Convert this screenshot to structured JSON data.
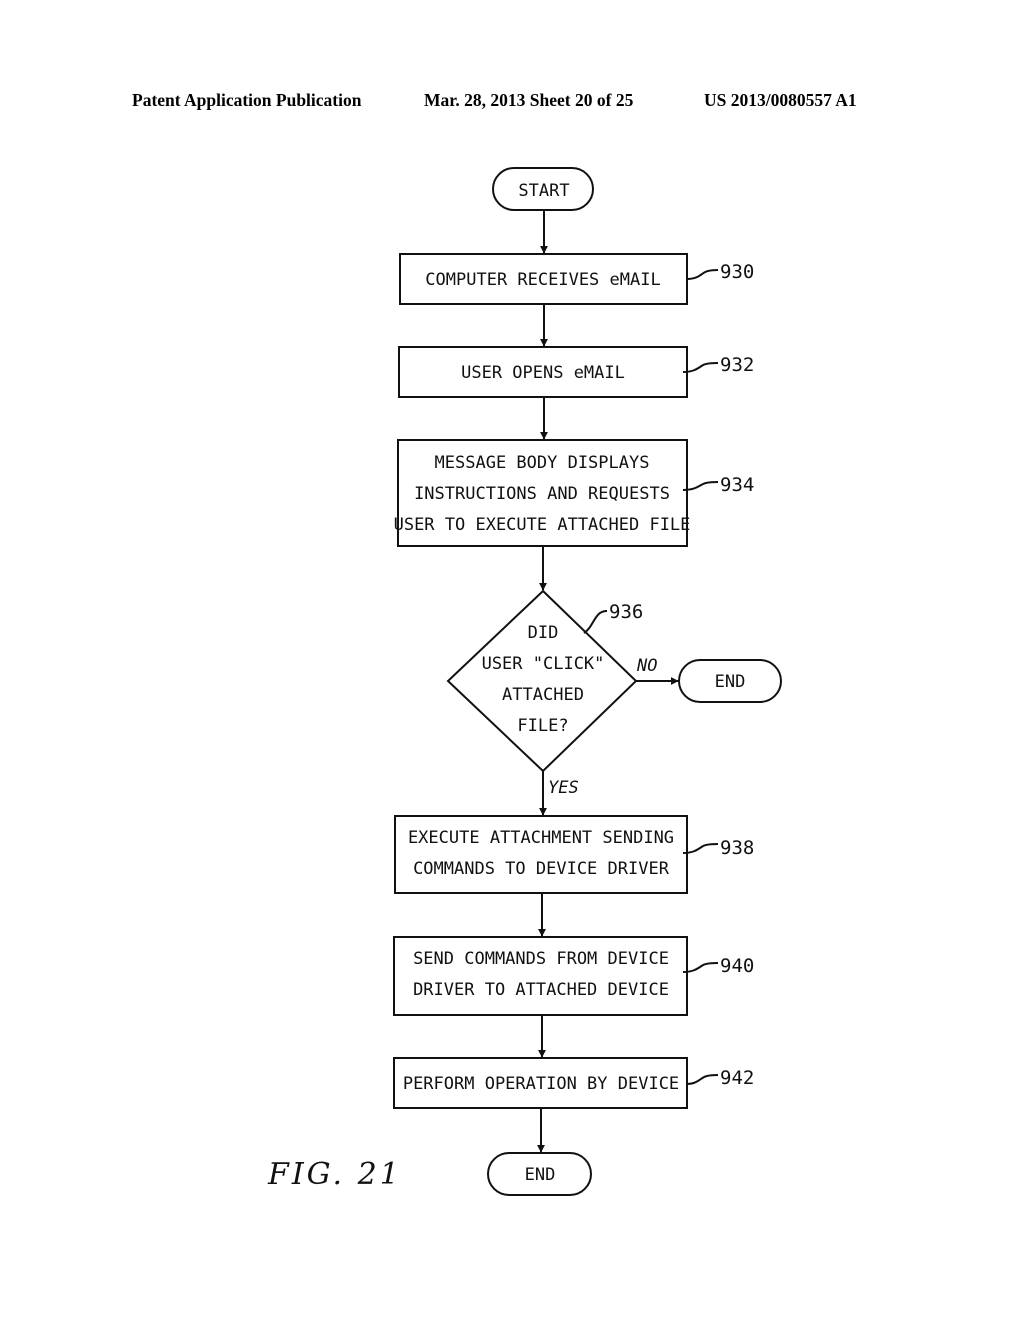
{
  "header": {
    "left": "Patent Application Publication",
    "middle": "Mar. 28, 2013  Sheet 20 of 25",
    "right": "US 2013/0080557 A1"
  },
  "figure_label": "FIG. 21",
  "flowchart": {
    "start": "START",
    "steps": [
      {
        "id": "930",
        "lines": [
          "COMPUTER RECEIVES eMAIL"
        ]
      },
      {
        "id": "932",
        "lines": [
          "USER OPENS eMAIL"
        ]
      },
      {
        "id": "934",
        "lines": [
          "MESSAGE BODY DISPLAYS",
          "INSTRUCTIONS AND REQUESTS",
          "USER TO EXECUTE ATTACHED FILE"
        ]
      }
    ],
    "decision": {
      "id": "936",
      "lines": [
        "DID",
        "USER \"CLICK\"",
        "ATTACHED",
        "FILE?"
      ],
      "no_label": "NO",
      "yes_label": "YES",
      "no_terminal": "END"
    },
    "after_steps": [
      {
        "id": "938",
        "lines": [
          "EXECUTE ATTACHMENT SENDING",
          "COMMANDS TO DEVICE DRIVER"
        ]
      },
      {
        "id": "940",
        "lines": [
          "SEND COMMANDS FROM DEVICE",
          "DRIVER TO ATTACHED DEVICE"
        ]
      },
      {
        "id": "942",
        "lines": [
          "PERFORM OPERATION BY DEVICE"
        ]
      }
    ],
    "end": "END"
  }
}
